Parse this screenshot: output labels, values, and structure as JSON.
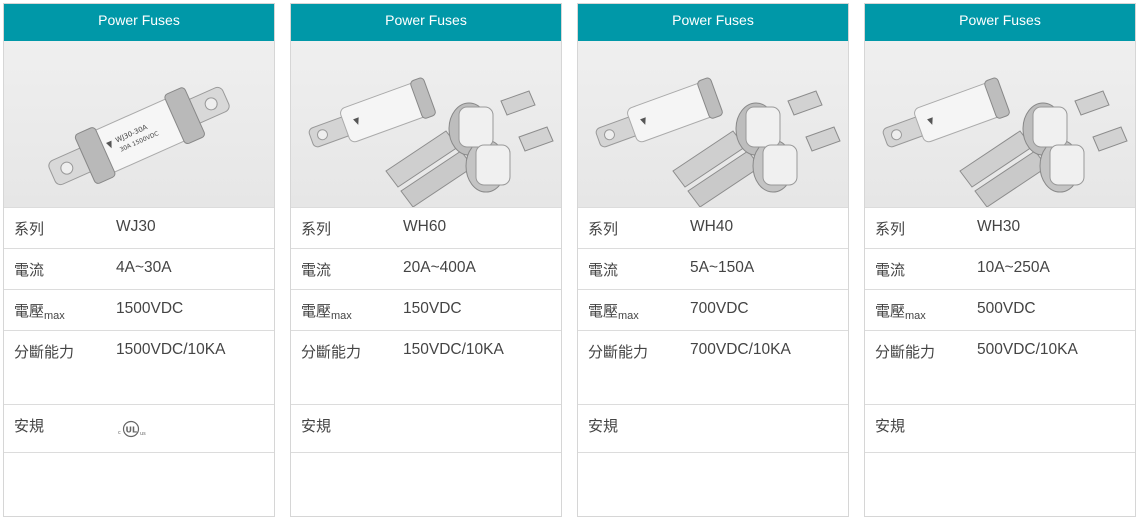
{
  "colors": {
    "header": "#0098a8",
    "border": "#d6d6d6"
  },
  "cards": [
    {
      "header": "Power Fuses",
      "image_alt": "WJ30 power fuse with slotted tab terminals",
      "rows": {
        "series_label": "系列",
        "series_value": "WJ30",
        "current_label": "電流",
        "current_value": "4A~30A",
        "voltage_label": "電壓",
        "voltage_sub": "max",
        "voltage_value": "1500VDC",
        "breaking_label": "分斷能力",
        "breaking_value": "1500VDC/10KA",
        "cert_label": "安規",
        "cert_icon": "ul-listed-icon"
      }
    },
    {
      "header": "Power Fuses",
      "image_alt": "WH60 power fuses",
      "rows": {
        "series_label": "系列",
        "series_value": "WH60",
        "current_label": "電流",
        "current_value": "20A~400A",
        "voltage_label": "電壓",
        "voltage_sub": "max",
        "voltage_value": "150VDC",
        "breaking_label": "分斷能力",
        "breaking_value": "150VDC/10KA",
        "cert_label": "安規"
      }
    },
    {
      "header": "Power Fuses",
      "image_alt": "WH40 power fuses",
      "rows": {
        "series_label": "系列",
        "series_value": "WH40",
        "current_label": "電流",
        "current_value": "5A~150A",
        "voltage_label": "電壓",
        "voltage_sub": "max",
        "voltage_value": "700VDC",
        "breaking_label": "分斷能力",
        "breaking_value": "700VDC/10KA",
        "cert_label": "安規"
      }
    },
    {
      "header": "Power Fuses",
      "image_alt": "WH30 power fuses",
      "rows": {
        "series_label": "系列",
        "series_value": "WH30",
        "current_label": "電流",
        "current_value": "10A~250A",
        "voltage_label": "電壓",
        "voltage_sub": "max",
        "voltage_value": "500VDC",
        "breaking_label": "分斷能力",
        "breaking_value": "500VDC/10KA",
        "cert_label": "安規"
      }
    }
  ]
}
